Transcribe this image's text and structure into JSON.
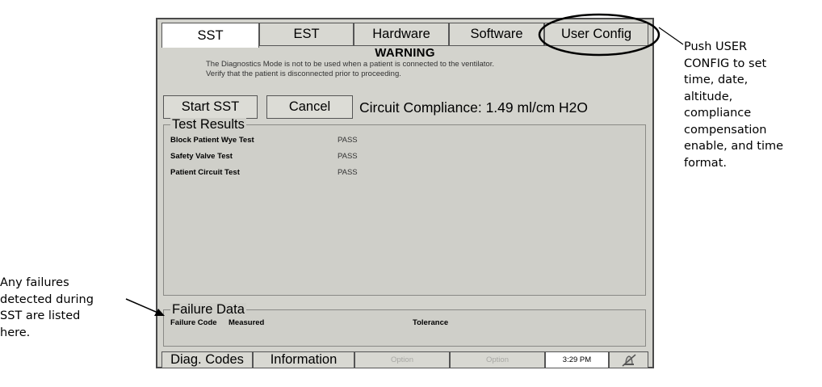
{
  "callouts": {
    "right": [
      "Push USER",
      "CONFIG to set",
      "time, date,",
      "altitude,",
      "compliance",
      "compensation",
      "enable, and time",
      "format."
    ],
    "left": [
      "Any failures",
      "detected during",
      "SST are listed",
      "here."
    ]
  },
  "tabs": [
    "SST",
    "EST",
    "Hardware",
    "Software",
    "User Config"
  ],
  "warning": {
    "title": "WARNING",
    "line1": "The Diagnostics Mode is not to be used when a patient is connected to the ventilator.",
    "line2": "Verify that the patient is disconnected prior to proceeding."
  },
  "actions": {
    "start": "Start SST",
    "cancel": "Cancel",
    "compliance": "Circuit Compliance: 1.49 ml/cm H2O"
  },
  "results": {
    "title": "Test Results",
    "rows": [
      {
        "name": "Block Patient Wye Test",
        "status": "PASS"
      },
      {
        "name": "Safety Valve Test",
        "status": "PASS"
      },
      {
        "name": "Patient Circuit Test",
        "status": "PASS"
      }
    ]
  },
  "failure": {
    "title": "Failure Data",
    "columns": [
      "Failure Code",
      "Measured",
      "Tolerance"
    ]
  },
  "bottom": {
    "buttons": [
      "Diag. Codes",
      "Information",
      "Option",
      "Option"
    ],
    "clock": "3:29 PM"
  },
  "icons": {
    "highlight_ellipse": "ellipse-outline",
    "alarm_silence": "bell-slash-icon"
  }
}
